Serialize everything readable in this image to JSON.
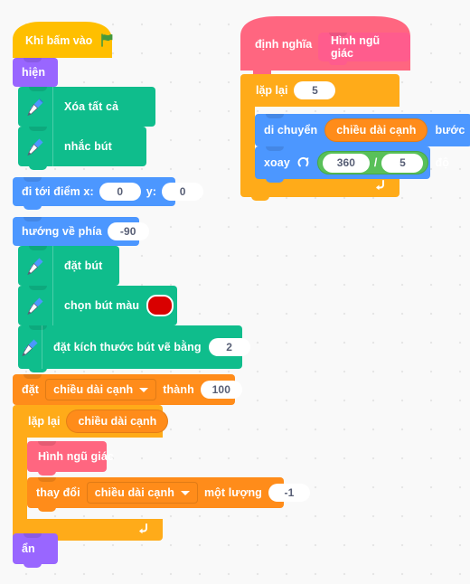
{
  "workspace": {
    "background_color": "#f9f9f9",
    "grid_dot_color": "#e6e6e6"
  },
  "palette": {
    "events_yellow": "#ffbf00",
    "looks_purple": "#9966ff",
    "pen_green": "#0fbd8c",
    "motion_blue": "#4c97ff",
    "control_orange": "#ffab19",
    "data_orange": "#ff8c1a",
    "custom_pink": "#ff6680",
    "operator_green": "#59c059",
    "pen_color_swatch": "#d90000",
    "flag_green": "#45993d"
  },
  "scripts": {
    "main": {
      "hat": {
        "label": "Khi bấm vào",
        "icon": "green-flag-icon"
      },
      "blocks": [
        {
          "id": "show",
          "label": "hiện"
        },
        {
          "id": "erase-all",
          "label": "Xóa tất cả",
          "icon": "pen-icon"
        },
        {
          "id": "pen-up",
          "label": "nhắc bút",
          "icon": "pen-icon"
        },
        {
          "id": "goto-xy",
          "label_1": "đi tới điểm x:",
          "value_x": "0",
          "label_2": "y:",
          "value_y": "0"
        },
        {
          "id": "point-direction",
          "label": "hướng về phía",
          "value": "-90"
        },
        {
          "id": "pen-down",
          "label": "đặt bút",
          "icon": "pen-icon"
        },
        {
          "id": "set-pen-color",
          "label": "chọn bút màu",
          "icon": "pen-icon",
          "swatch": "#d90000"
        },
        {
          "id": "set-pen-size",
          "label": "đặt kích thước bút vẽ bằng",
          "icon": "pen-icon",
          "value": "2"
        },
        {
          "id": "set-variable",
          "label_1": "đặt",
          "variable": "chiều dài cạnh",
          "label_2": "thành",
          "value": "100"
        }
      ],
      "repeat_loop": {
        "label": "lặp lại",
        "times_variable": "chiều dài cạnh",
        "body": [
          {
            "id": "call-pentagon",
            "label": "Hình ngũ giác"
          },
          {
            "id": "change-variable",
            "label_1": "thay đổi",
            "variable": "chiều dài cạnh",
            "label_2": "một lượng",
            "value": "-1"
          }
        ],
        "loop_icon": "loop-arrow-icon"
      },
      "after_loop": {
        "id": "hide",
        "label": "ẩn"
      }
    },
    "definition": {
      "hat": {
        "label": "định nghĩa",
        "procedure_name": "Hình ngũ giác"
      },
      "repeat_loop": {
        "label": "lặp lại",
        "times": "5",
        "body": [
          {
            "id": "move-steps",
            "label_1": "di chuyển",
            "variable": "chiều dài cạnh",
            "label_2": "bước"
          },
          {
            "id": "turn-right",
            "label_1": "xoay",
            "icon": "turn-clockwise-icon",
            "operand_a": "360",
            "operator": "/",
            "operand_b": "5",
            "label_2": "độ"
          }
        ],
        "loop_icon": "loop-arrow-icon"
      }
    }
  }
}
